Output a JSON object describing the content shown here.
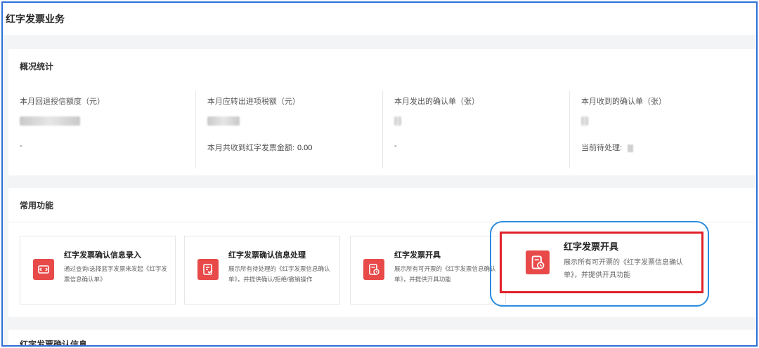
{
  "header": {
    "title": "红字发票业务"
  },
  "stats": {
    "title": "概况统计",
    "items": [
      {
        "label": "本月回退授信额度（元）",
        "foot": "-"
      },
      {
        "label": "本月应转出进项税额（元）",
        "foot": "本月共收到红字发票金额:",
        "foot_value": "0.00"
      },
      {
        "label": "本月发出的确认单（张）",
        "foot": "-"
      },
      {
        "label": "本月收到的确认单（张）",
        "foot": "当前待处理:"
      }
    ]
  },
  "functions": {
    "title": "常用功能",
    "items": [
      {
        "name": "红字发票确认信息录入",
        "desc": "通过查询/选择蓝字发票来发起《红字发票信息确认单》",
        "icon": "arrows-exchange-icon"
      },
      {
        "name": "红字发票确认信息处理",
        "desc": "展示所有待处理的《红字发票信息确认单》，并提供确认/拒绝/撤销操作",
        "icon": "document-check-icon"
      },
      {
        "name": "红字发票开具",
        "desc": "展示所有可开票的《红字发票信息确认单》，并提供开具功能",
        "icon": "invoice-clock-icon"
      }
    ],
    "highlight": {
      "name": "红字发票开具",
      "desc": "展示所有可开票的《红字发票信息确认单》，并提供开具功能",
      "icon": "invoice-clock-icon"
    }
  },
  "bottom": {
    "title": "红字发票确认信息"
  },
  "colors": {
    "accent_red": "#e84a4a",
    "highlight_blue": "#2a8be0",
    "highlight_red": "#e0202a",
    "frame_blue": "#2f6fd6"
  }
}
